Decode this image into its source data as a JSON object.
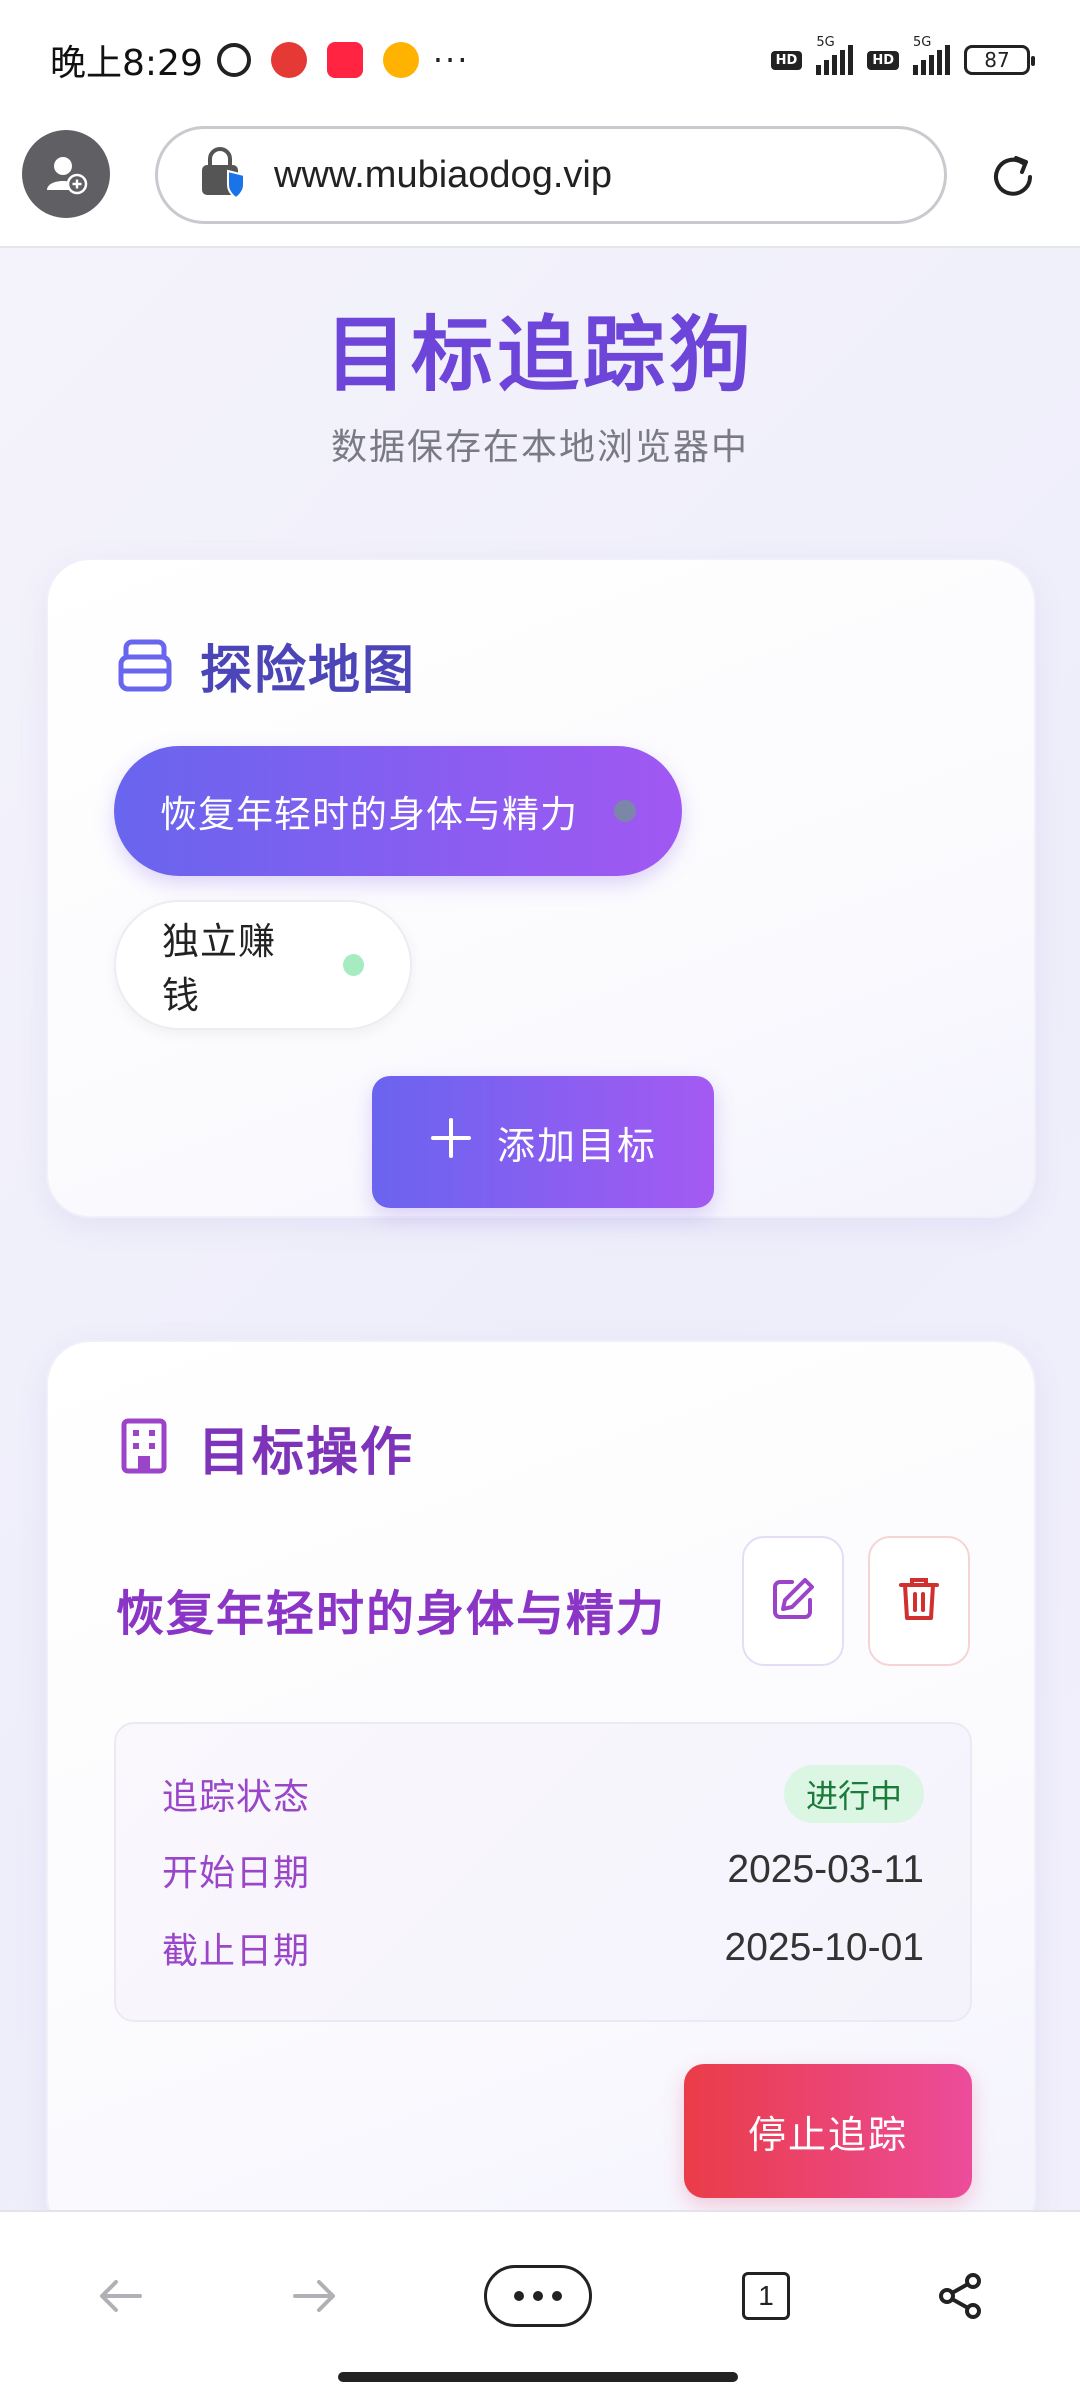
{
  "status_bar": {
    "time": "晚上8:29",
    "more": "···",
    "hd": "HD",
    "network": "5G",
    "battery": "87"
  },
  "browser": {
    "url": "www.mubiaodog.vip"
  },
  "page": {
    "title": "目标追踪狗",
    "subtitle": "数据保存在本地浏览器中"
  },
  "map_card": {
    "title": "探险地图",
    "goals": [
      {
        "label": "恢复年轻时的身体与精力",
        "active": true
      },
      {
        "label": "独立赚钱",
        "active": false
      }
    ],
    "add_button": "添加目标"
  },
  "ops_card": {
    "title": "目标操作",
    "goal_name": "恢复年轻时的身体与精力",
    "info": {
      "status_label": "追踪状态",
      "status_value": "进行中",
      "start_label": "开始日期",
      "start_value": "2025-03-11",
      "end_label": "截止日期",
      "end_value": "2025-10-01"
    },
    "stop_button": "停止追踪"
  },
  "bottom_nav": {
    "tab_count": "1"
  },
  "colors": {
    "accent": "#6d45d8",
    "accent_gradient_start": "#6865ee",
    "accent_gradient_end": "#a158f2",
    "danger_gradient_start": "#ea3c48",
    "danger_gradient_end": "#ec4c9a",
    "status_green": "#1c7a3d"
  },
  "icons": [
    "alarm-icon",
    "app-icon",
    "app-icon",
    "weibo-icon",
    "signal-icon",
    "battery-icon",
    "user-avatar-icon",
    "lock-shield-icon",
    "reload-icon",
    "archive-icon",
    "building-icon",
    "plus-icon",
    "edit-icon",
    "trash-icon",
    "back-arrow-icon",
    "forward-arrow-icon",
    "menu-dots-icon",
    "tabs-icon",
    "share-icon"
  ]
}
